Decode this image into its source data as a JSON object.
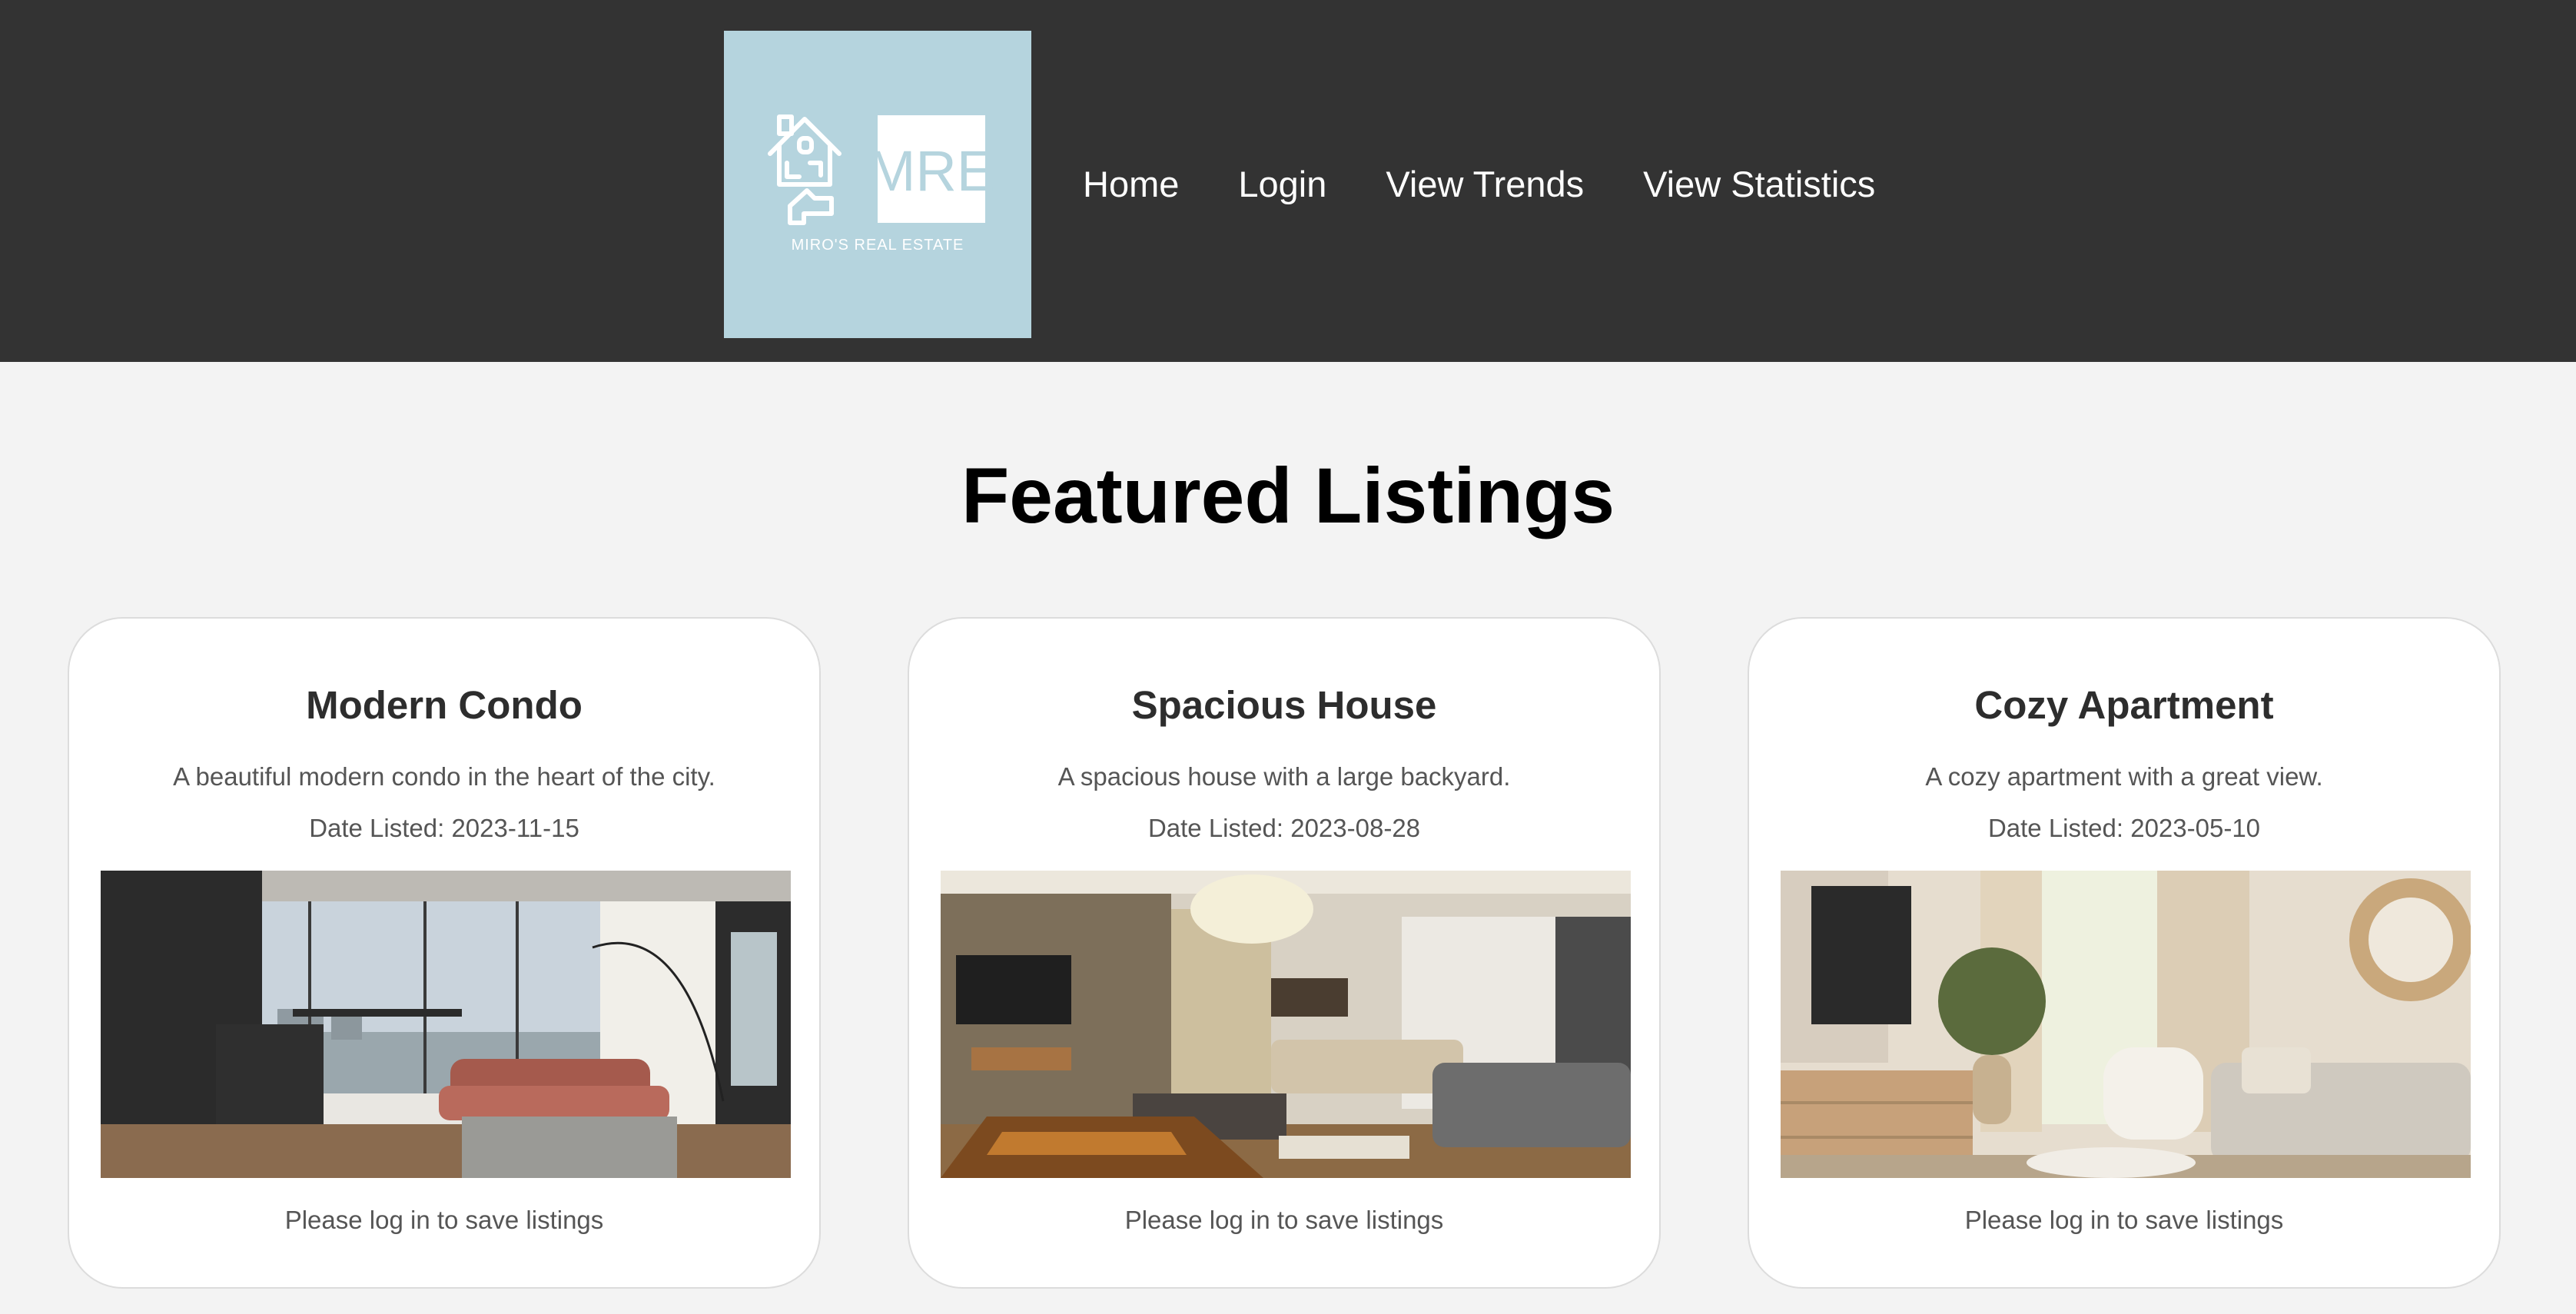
{
  "header": {
    "logo": {
      "letters": "MRE",
      "tagline": "MIRO'S REAL ESTATE",
      "icon": "house-key-icon",
      "background": "#b5d4de"
    },
    "nav": [
      "Home",
      "Login",
      "View Trends",
      "View Statistics"
    ],
    "background": "#333333"
  },
  "main": {
    "title": "Featured Listings",
    "listings": [
      {
        "title": "Modern Condo",
        "description": "A beautiful modern condo in the heart of the city.",
        "date": "Date Listed: 2023-11-15",
        "image": "modern-condo-living-room-photo",
        "note": "Please log in to save listings"
      },
      {
        "title": "Spacious House",
        "description": "A spacious house with a large backyard.",
        "date": "Date Listed: 2023-08-28",
        "image": "spacious-house-living-room-photo",
        "note": "Please log in to save listings"
      },
      {
        "title": "Cozy Apartment",
        "description": "A cozy apartment with a great view.",
        "date": "Date Listed: 2023-05-10",
        "image": "cozy-apartment-living-room-photo",
        "note": "Please log in to save listings"
      }
    ]
  }
}
